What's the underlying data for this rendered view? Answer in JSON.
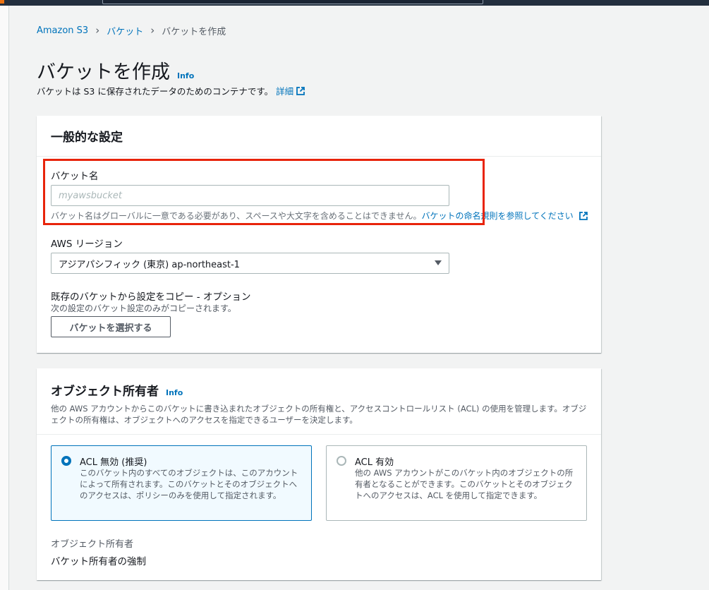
{
  "breadcrumb": {
    "items": [
      "Amazon S3",
      "バケット"
    ],
    "current": "バケットを作成"
  },
  "page": {
    "title": "バケットを作成",
    "info": "Info",
    "description": "バケットは S3 に保存されたデータのためのコンテナです。",
    "details_link": "詳細"
  },
  "general": {
    "title": "一般的な設定",
    "bucket_name_label": "バケット名",
    "bucket_name_value": "",
    "bucket_name_placeholder": "myawsbucket",
    "bucket_name_hint": "バケット名はグローバルに一意である必要があり、スペースや大文字を含めることはできません。",
    "bucket_name_rules_link": "バケットの命名規則を参照してください",
    "region_label": "AWS リージョン",
    "region_value": "アジアパシフィック (東京) ap-northeast-1",
    "copy_label": "既存のバケットから設定をコピー - オプション",
    "copy_hint": "次の設定のバケット設定のみがコピーされます。",
    "choose_bucket_button": "バケットを選択する"
  },
  "ownership": {
    "title": "オブジェクト所有者",
    "info": "Info",
    "description": "他の AWS アカウントからこのバケットに書き込まれたオブジェクトの所有権と、アクセスコントロールリスト (ACL) の使用を管理します。オブジェクトの所有権は、オブジェクトへのアクセスを指定できるユーザーを決定します。",
    "options": [
      {
        "title": "ACL 無効 (推奨)",
        "description": "このバケット内のすべてのオブジェクトは、このアカウントによって所有されます。このバケットとそのオブジェクトへのアクセスは、ポリシーのみを使用して指定されます。",
        "selected": true
      },
      {
        "title": "ACL 有効",
        "description": "他の AWS アカウントがこのバケット内のオブジェクトの所有者となることができます。このバケットとそのオブジェクトへのアクセスは、ACL を使用して指定できます。",
        "selected": false
      }
    ],
    "owner_label": "オブジェクト所有者",
    "owner_value": "バケット所有者の強制"
  },
  "colors": {
    "link": "#0073bb",
    "highlight": "#e8240b",
    "topbar": "#232f3e"
  }
}
